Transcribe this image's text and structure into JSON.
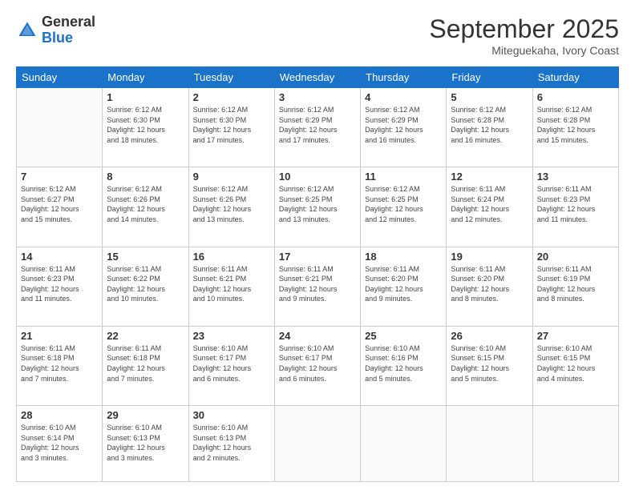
{
  "header": {
    "logo_general": "General",
    "logo_blue": "Blue",
    "month_title": "September 2025",
    "location": "Miteguekaha, Ivory Coast"
  },
  "calendar": {
    "headers": [
      "Sunday",
      "Monday",
      "Tuesday",
      "Wednesday",
      "Thursday",
      "Friday",
      "Saturday"
    ],
    "weeks": [
      [
        {
          "day": "",
          "info": ""
        },
        {
          "day": "1",
          "info": "Sunrise: 6:12 AM\nSunset: 6:30 PM\nDaylight: 12 hours\nand 18 minutes."
        },
        {
          "day": "2",
          "info": "Sunrise: 6:12 AM\nSunset: 6:30 PM\nDaylight: 12 hours\nand 17 minutes."
        },
        {
          "day": "3",
          "info": "Sunrise: 6:12 AM\nSunset: 6:29 PM\nDaylight: 12 hours\nand 17 minutes."
        },
        {
          "day": "4",
          "info": "Sunrise: 6:12 AM\nSunset: 6:29 PM\nDaylight: 12 hours\nand 16 minutes."
        },
        {
          "day": "5",
          "info": "Sunrise: 6:12 AM\nSunset: 6:28 PM\nDaylight: 12 hours\nand 16 minutes."
        },
        {
          "day": "6",
          "info": "Sunrise: 6:12 AM\nSunset: 6:28 PM\nDaylight: 12 hours\nand 15 minutes."
        }
      ],
      [
        {
          "day": "7",
          "info": "Sunrise: 6:12 AM\nSunset: 6:27 PM\nDaylight: 12 hours\nand 15 minutes."
        },
        {
          "day": "8",
          "info": "Sunrise: 6:12 AM\nSunset: 6:26 PM\nDaylight: 12 hours\nand 14 minutes."
        },
        {
          "day": "9",
          "info": "Sunrise: 6:12 AM\nSunset: 6:26 PM\nDaylight: 12 hours\nand 13 minutes."
        },
        {
          "day": "10",
          "info": "Sunrise: 6:12 AM\nSunset: 6:25 PM\nDaylight: 12 hours\nand 13 minutes."
        },
        {
          "day": "11",
          "info": "Sunrise: 6:12 AM\nSunset: 6:25 PM\nDaylight: 12 hours\nand 12 minutes."
        },
        {
          "day": "12",
          "info": "Sunrise: 6:11 AM\nSunset: 6:24 PM\nDaylight: 12 hours\nand 12 minutes."
        },
        {
          "day": "13",
          "info": "Sunrise: 6:11 AM\nSunset: 6:23 PM\nDaylight: 12 hours\nand 11 minutes."
        }
      ],
      [
        {
          "day": "14",
          "info": "Sunrise: 6:11 AM\nSunset: 6:23 PM\nDaylight: 12 hours\nand 11 minutes."
        },
        {
          "day": "15",
          "info": "Sunrise: 6:11 AM\nSunset: 6:22 PM\nDaylight: 12 hours\nand 10 minutes."
        },
        {
          "day": "16",
          "info": "Sunrise: 6:11 AM\nSunset: 6:21 PM\nDaylight: 12 hours\nand 10 minutes."
        },
        {
          "day": "17",
          "info": "Sunrise: 6:11 AM\nSunset: 6:21 PM\nDaylight: 12 hours\nand 9 minutes."
        },
        {
          "day": "18",
          "info": "Sunrise: 6:11 AM\nSunset: 6:20 PM\nDaylight: 12 hours\nand 9 minutes."
        },
        {
          "day": "19",
          "info": "Sunrise: 6:11 AM\nSunset: 6:20 PM\nDaylight: 12 hours\nand 8 minutes."
        },
        {
          "day": "20",
          "info": "Sunrise: 6:11 AM\nSunset: 6:19 PM\nDaylight: 12 hours\nand 8 minutes."
        }
      ],
      [
        {
          "day": "21",
          "info": "Sunrise: 6:11 AM\nSunset: 6:18 PM\nDaylight: 12 hours\nand 7 minutes."
        },
        {
          "day": "22",
          "info": "Sunrise: 6:11 AM\nSunset: 6:18 PM\nDaylight: 12 hours\nand 7 minutes."
        },
        {
          "day": "23",
          "info": "Sunrise: 6:10 AM\nSunset: 6:17 PM\nDaylight: 12 hours\nand 6 minutes."
        },
        {
          "day": "24",
          "info": "Sunrise: 6:10 AM\nSunset: 6:17 PM\nDaylight: 12 hours\nand 6 minutes."
        },
        {
          "day": "25",
          "info": "Sunrise: 6:10 AM\nSunset: 6:16 PM\nDaylight: 12 hours\nand 5 minutes."
        },
        {
          "day": "26",
          "info": "Sunrise: 6:10 AM\nSunset: 6:15 PM\nDaylight: 12 hours\nand 5 minutes."
        },
        {
          "day": "27",
          "info": "Sunrise: 6:10 AM\nSunset: 6:15 PM\nDaylight: 12 hours\nand 4 minutes."
        }
      ],
      [
        {
          "day": "28",
          "info": "Sunrise: 6:10 AM\nSunset: 6:14 PM\nDaylight: 12 hours\nand 3 minutes."
        },
        {
          "day": "29",
          "info": "Sunrise: 6:10 AM\nSunset: 6:13 PM\nDaylight: 12 hours\nand 3 minutes."
        },
        {
          "day": "30",
          "info": "Sunrise: 6:10 AM\nSunset: 6:13 PM\nDaylight: 12 hours\nand 2 minutes."
        },
        {
          "day": "",
          "info": ""
        },
        {
          "day": "",
          "info": ""
        },
        {
          "day": "",
          "info": ""
        },
        {
          "day": "",
          "info": ""
        }
      ]
    ]
  }
}
